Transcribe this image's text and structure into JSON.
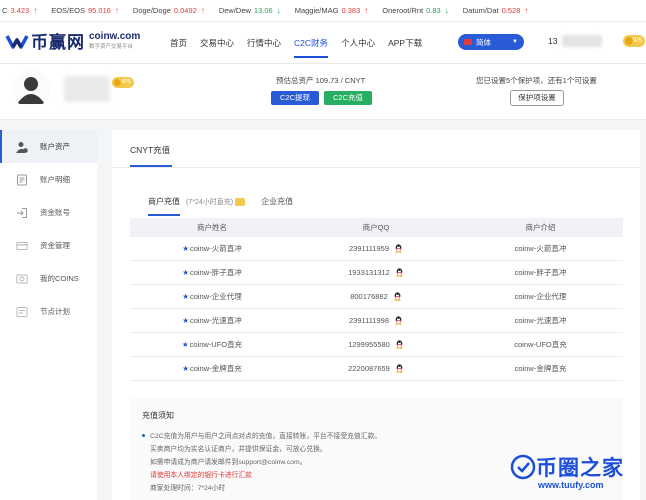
{
  "ticker": [
    {
      "name": "C",
      "price": "3.423",
      "dir": "up"
    },
    {
      "name": "EOS/EOS",
      "price": "95.016",
      "dir": "up"
    },
    {
      "name": "Doge/Doge",
      "price": "0.0492",
      "dir": "up"
    },
    {
      "name": "Dew/Dew",
      "price": "13.06",
      "dir": "down"
    },
    {
      "name": "Maggie/MAG",
      "price": "0.383",
      "dir": "up"
    },
    {
      "name": "Oneroot/Rnt",
      "price": "0.83",
      "dir": "down"
    },
    {
      "name": "Datum/Dat",
      "price": "0.528",
      "dir": "up"
    }
  ],
  "header": {
    "logo_cn": "币赢网",
    "logo_domain": "coinw.com",
    "logo_tagline": "数字资产交易平台",
    "nav": [
      {
        "label": "首页",
        "active": false
      },
      {
        "label": "交易中心",
        "active": false
      },
      {
        "label": "行情中心",
        "active": false
      },
      {
        "label": "C2C财务",
        "active": true
      },
      {
        "label": "个人中心",
        "active": false
      },
      {
        "label": "APP下载",
        "active": false
      }
    ],
    "language": "简体",
    "user_prefix": "13",
    "vip": "VIP5"
  },
  "profile": {
    "vip": "VIP5",
    "assets_label": "预估总资产 109.73 / CNYT",
    "withdraw_button": "C2C提现",
    "deposit_button": "C2C充值",
    "protection_text": "您已设置5个保护项，还有1个可设置",
    "protection_button": "保护项设置"
  },
  "sidebar": {
    "items": [
      {
        "label": "账户资产",
        "icon": "user-coin-icon",
        "active": true
      },
      {
        "label": "账户明细",
        "icon": "ledger-icon",
        "active": false
      },
      {
        "label": "资金账号",
        "icon": "login-icon",
        "active": false
      },
      {
        "label": "资金管理",
        "icon": "card-icon",
        "active": false
      },
      {
        "label": "我的COINS",
        "icon": "coins-icon",
        "active": false
      },
      {
        "label": "节点计划",
        "icon": "plan-icon",
        "active": false
      }
    ]
  },
  "main": {
    "title": "CNYT充值",
    "tabs": {
      "merchant": "商户充值",
      "merchant_note": "(7*24小时直充)",
      "enterprise": "企业充值"
    },
    "columns": [
      "商户姓名",
      "商户QQ",
      "商户介绍"
    ],
    "rows": [
      {
        "name": "coinw-火箭直冲",
        "qq": "2391111959",
        "intro": "coinw-火箭直冲"
      },
      {
        "name": "coinw-胖子直冲",
        "qq": "1933131312",
        "intro": "coinw-胖子直冲"
      },
      {
        "name": "coinw-企业代理",
        "qq": "800176882",
        "intro": "coinw-企业代理"
      },
      {
        "name": "coinw-光速直冲",
        "qq": "2391111998",
        "intro": "coinw-光速直冲"
      },
      {
        "name": "coinw-UFO直充",
        "qq": "1299955580",
        "intro": "coinw-UFO直充"
      },
      {
        "name": "coinw-金牌直充",
        "qq": "2220087659",
        "intro": "coinw-金牌直充"
      }
    ],
    "notice": {
      "title": "充值须知",
      "line1": "C2C充值为用户与用户之间点对点的充值，直接转账，平台不接受充值汇款。",
      "line2": "买卖商户均为实名认证商户，并提供保证金，可放心兑换。",
      "line3": "如需申请成为商户请发邮件到support@coinw.com。",
      "line4": "请使用本人绑定的银行卡进行汇款",
      "line5": "商家处理时间：7*24小时"
    }
  },
  "watermark": {
    "title": "币圈之家",
    "url": "www.tuufy.com"
  }
}
